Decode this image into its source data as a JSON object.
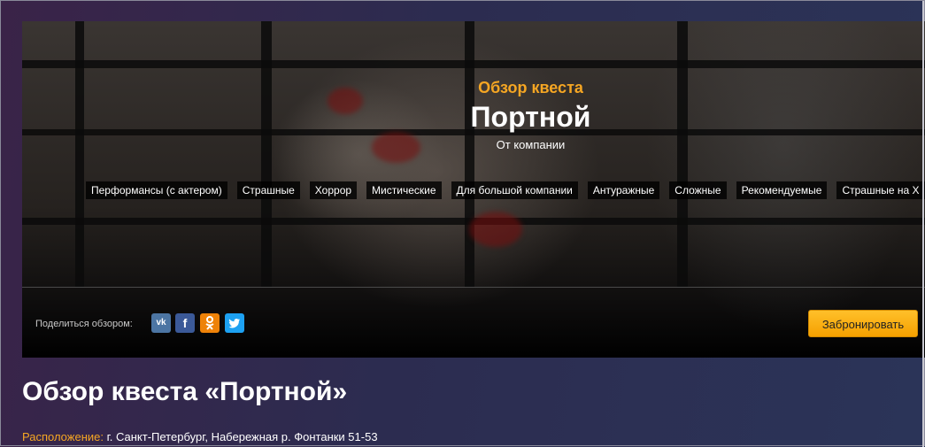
{
  "hero": {
    "subtitle": "Обзор квеста",
    "title": "Портной",
    "company_label": "От компании",
    "tags": [
      "Перформансы (с актером)",
      "Страшные",
      "Хоррор",
      "Мистические",
      "Для большой компании",
      "Антуражные",
      "Сложные",
      "Рекомендуемые",
      "Страшные на Х"
    ]
  },
  "share": {
    "label": "Поделиться обзором:",
    "networks": [
      {
        "name": "vk",
        "glyph": "vk"
      },
      {
        "name": "facebook",
        "glyph": "f"
      },
      {
        "name": "odnoklassniki",
        "glyph": "ok"
      },
      {
        "name": "twitter",
        "glyph": "t"
      }
    ]
  },
  "book_button": "Забронировать",
  "page": {
    "heading": "Обзор квеста «Портной»",
    "location_label": "Расположение:",
    "location_value": " г. Санкт-Петербург, Набережная р. Фонтанки 51-53"
  },
  "colors": {
    "accent": "#f5a623",
    "button": "#fbb317",
    "vk": "#4c75a3",
    "facebook": "#3b5998",
    "odnoklassniki": "#ee8208",
    "twitter": "#1da1f2"
  }
}
